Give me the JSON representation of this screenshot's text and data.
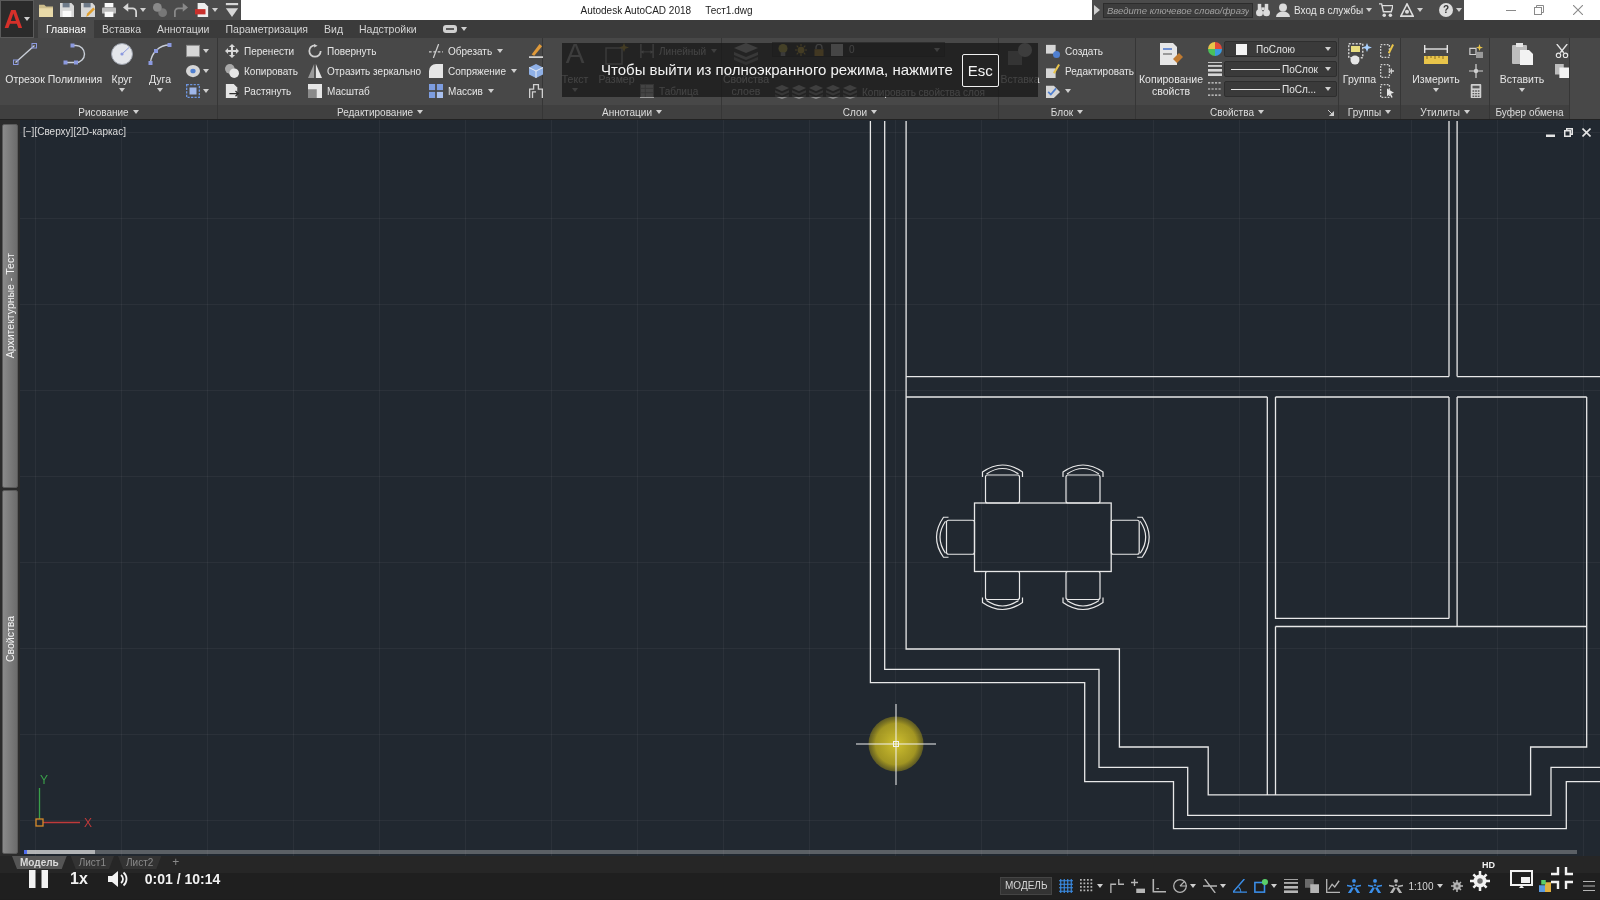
{
  "app_button": {
    "glyph": "A"
  },
  "quick_access": [
    {
      "kind": "open",
      "disabled": false,
      "dropdown": false
    },
    {
      "kind": "save",
      "disabled": false,
      "dropdown": false
    },
    {
      "kind": "save_as",
      "disabled": false,
      "dropdown": false
    },
    {
      "kind": "print",
      "disabled": false,
      "dropdown": false
    },
    {
      "kind": "undo",
      "disabled": false,
      "dropdown": true
    },
    {
      "kind": "share",
      "disabled": true,
      "dropdown": false
    },
    {
      "kind": "redo",
      "disabled": true,
      "dropdown": false
    },
    {
      "kind": "publish",
      "disabled": false,
      "dropdown": true
    },
    {
      "kind": "customize",
      "disabled": false,
      "dropdown": false
    }
  ],
  "title": {
    "app": "Autodesk AutoCAD 2018",
    "file": "Тест1.dwg"
  },
  "infocenter": {
    "search": {
      "placeholder": "Введите ключевое слово/фразу"
    },
    "sign_in": "Вход в службы",
    "help": "?"
  },
  "tabs": [
    {
      "label": "Главная",
      "selected": true
    },
    {
      "label": "Вставка",
      "selected": false
    },
    {
      "label": "Аннотации",
      "selected": false
    },
    {
      "label": "Параметризация",
      "selected": false
    },
    {
      "label": "Вид",
      "selected": false
    },
    {
      "label": "Надстройки",
      "selected": false
    }
  ],
  "ribbon": {
    "draw": {
      "title": "Рисование",
      "dropdown": true,
      "tools": [
        {
          "label": "Отрезок",
          "kind": "line",
          "dropdown": false
        },
        {
          "label": "Полилиния",
          "kind": "polyline",
          "dropdown": false
        },
        {
          "label": "Круг",
          "kind": "circle",
          "dropdown": true
        },
        {
          "label": "Дуга",
          "kind": "arc",
          "dropdown": true
        }
      ],
      "small_tools": [
        {
          "kind": "rectangle",
          "dropdown": true
        },
        {
          "kind": "hatch",
          "dropdown": true
        },
        {
          "kind": "boundary",
          "dropdown": true
        }
      ]
    },
    "modify": {
      "title": "Редактирование",
      "dropdown": true,
      "tools": [
        {
          "label": "Перенести",
          "kind": "move",
          "dropdown": false
        },
        {
          "label": "Копировать",
          "kind": "copy",
          "dropdown": false
        },
        {
          "label": "Растянуть",
          "kind": "stretch",
          "dropdown": false
        },
        {
          "label": "Повернуть",
          "kind": "rotate",
          "dropdown": false
        },
        {
          "label": "Отразить зеркально",
          "kind": "mirror",
          "dropdown": false
        },
        {
          "label": "Масштаб",
          "kind": "scale",
          "dropdown": false
        },
        {
          "label": "Обрезать",
          "kind": "trim",
          "dropdown": true
        },
        {
          "label": "Сопряжение",
          "kind": "fillet",
          "dropdown": true
        },
        {
          "label": "Массив",
          "kind": "array",
          "dropdown": true
        }
      ],
      "small_tools": [
        {
          "kind": "erase"
        },
        {
          "kind": "explode"
        },
        {
          "kind": "offset"
        }
      ]
    },
    "annotation": {
      "title": "Аннотации",
      "dropdown": true,
      "text": {
        "glyph": "A",
        "label": "Текст"
      },
      "dimension": {
        "label": "Размер"
      },
      "linear": {
        "label": "Линейный"
      },
      "table": {
        "label": "Таблица"
      }
    },
    "layers": {
      "title": "Слои",
      "dropdown": true,
      "properties": {
        "lines": [
          "Свойства",
          "слоев"
        ]
      },
      "current_layer": {
        "value": "0"
      },
      "copy_properties": "Копировать свойства слоя"
    },
    "block": {
      "title": "Блок",
      "dropdown": true,
      "insert": "Вставка",
      "tools": [
        {
          "label": "Создать",
          "kind": "create",
          "dropdown": false
        },
        {
          "label": "Редактировать",
          "kind": "edit",
          "dropdown": false
        },
        {
          "kind": "attribute",
          "dropdown": true
        }
      ]
    },
    "properties": {
      "title": "Свойства",
      "dropdown": true,
      "match": {
        "lines": [
          "Копирование",
          "свойств"
        ]
      },
      "combos": [
        {
          "kind": "color",
          "value": "ПоСлою"
        },
        {
          "kind": "lineweight",
          "value": "ПоСлок"
        },
        {
          "kind": "linetype",
          "value": "ПоСл..."
        }
      ]
    },
    "groups": {
      "title": "Группы",
      "dropdown": true,
      "group": "Группа",
      "small_tools": [
        {
          "kind": "group_edit"
        },
        {
          "kind": "group_add"
        },
        {
          "kind": "group_select"
        }
      ]
    },
    "utilities": {
      "title": "Утилиты",
      "dropdown": true,
      "measure": "Измерить",
      "small_tools": [
        {
          "kind": "quick_select"
        },
        {
          "kind": "point"
        },
        {
          "kind": "calculator"
        }
      ]
    },
    "clipboard": {
      "title": "Буфер обмена",
      "dropdown": false,
      "paste": "Вставить",
      "small_tools": [
        {
          "kind": "cut"
        },
        {
          "kind": "copy_clip"
        }
      ]
    }
  },
  "fullscreen_hint": {
    "message": "Чтобы выйти из полноэкранного режима, нажмите",
    "key": "Esc"
  },
  "palettes": [
    {
      "label": "Архитектурные - Тест"
    },
    {
      "label": "Свойства"
    }
  ],
  "viewport": {
    "label": "[−][Сверху][2D-каркас]",
    "ucs": {
      "x": "X",
      "y": "Y"
    }
  },
  "layout_tabs": {
    "tabs": [
      {
        "label": "Модель",
        "selected": true
      },
      {
        "label": "Лист1",
        "selected": false
      },
      {
        "label": "Лист2",
        "selected": false
      }
    ],
    "add": "+"
  },
  "status_bar": {
    "space": "МОДЕЛЬ",
    "toggles": [
      {
        "kind": "grid",
        "on": true,
        "dropdown": false
      },
      {
        "kind": "snap",
        "on": false,
        "dropdown": true
      },
      {
        "kind": "infer",
        "on": false,
        "dropdown": false
      },
      {
        "kind": "dynamic_input",
        "on": false,
        "dropdown": false
      },
      {
        "kind": "ortho",
        "on": false,
        "dropdown": false
      },
      {
        "kind": "polar",
        "on": false,
        "dropdown": true
      },
      {
        "kind": "isodraft",
        "on": false,
        "dropdown": true
      },
      {
        "kind": "tracking",
        "on": true,
        "dropdown": false
      },
      {
        "kind": "osnap",
        "on": true,
        "dropdown": true
      },
      {
        "kind": "lineweight",
        "on": false,
        "dropdown": false
      },
      {
        "kind": "transparency",
        "on": false,
        "dropdown": false
      },
      {
        "kind": "selection",
        "on": false,
        "dropdown": false
      },
      {
        "kind": "annotation",
        "on": true,
        "dropdown": false
      },
      {
        "kind": "autoscale",
        "on": true,
        "dropdown": false
      },
      {
        "kind": "annoscale",
        "on": false,
        "dropdown": false
      }
    ],
    "scale": "1:100",
    "tools": [
      {
        "kind": "workspace"
      },
      {
        "kind": "hardware"
      },
      {
        "kind": "menu"
      }
    ]
  },
  "video": {
    "progress": {
      "level": 0.002
    },
    "buffer": {
      "level": 0.046
    },
    "playing": true,
    "speed": "1x",
    "muted": false,
    "time": "0:01 / 10:14",
    "quality": "HD"
  }
}
